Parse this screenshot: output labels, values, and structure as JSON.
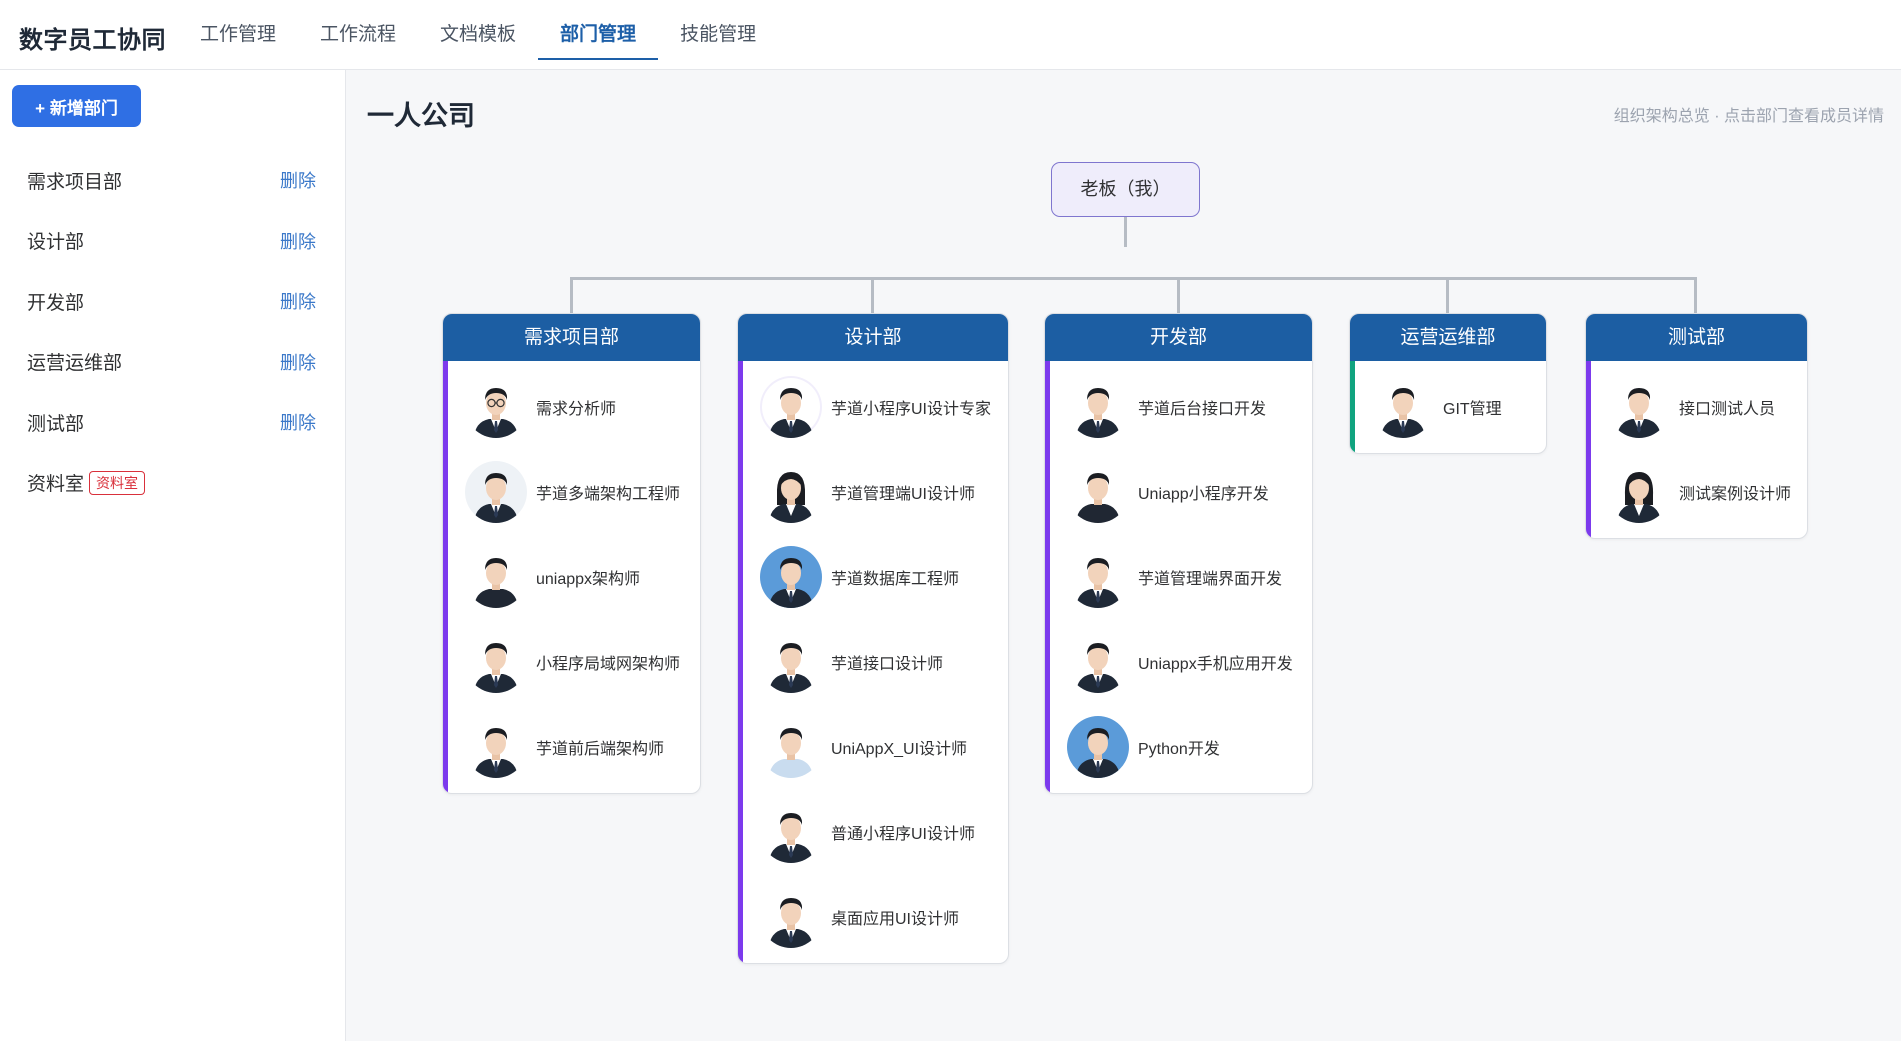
{
  "app": {
    "title": "数字员工协同"
  },
  "nav": {
    "items": [
      {
        "label": "工作管理",
        "active": false
      },
      {
        "label": "工作流程",
        "active": false
      },
      {
        "label": "文档模板",
        "active": false
      },
      {
        "label": "部门管理",
        "active": true
      },
      {
        "label": "技能管理",
        "active": false
      }
    ]
  },
  "sidebar": {
    "add_button": "+ 新增部门",
    "departments": [
      {
        "name": "需求项目部",
        "action": "删除"
      },
      {
        "name": "设计部",
        "action": "删除"
      },
      {
        "name": "开发部",
        "action": "删除"
      },
      {
        "name": "运营运维部",
        "action": "删除"
      },
      {
        "name": "测试部",
        "action": "删除"
      }
    ],
    "archive": {
      "name": "资料室",
      "tag": "资料室"
    }
  },
  "main": {
    "title": "一人公司",
    "hint": "组织架构总览 · 点击部门查看成员详情",
    "root": "老板（我）",
    "colors": {
      "header": "#1c5ea3",
      "accent_purple": "#7c3aed",
      "accent_green": "#10a37f",
      "primary": "#2f6fe4"
    },
    "departments": [
      {
        "name": "需求项目部",
        "members": [
          "需求分析师",
          "芋道多端架构工程师",
          "uniappx架构师",
          "小程序局域网架构师",
          "芋道前后端架构师"
        ]
      },
      {
        "name": "设计部",
        "members": [
          "芋道小程序UI设计专家",
          "芋道管理端UI设计师",
          "芋道数据库工程师",
          "芋道接口设计师",
          "UniAppX_UI设计师",
          "普通小程序UI设计师",
          "桌面应用UI设计师"
        ]
      },
      {
        "name": "开发部",
        "members": [
          "芋道后台接口开发",
          "Uniapp小程序开发",
          "芋道管理端界面开发",
          "Uniappx手机应用开发",
          "Python开发"
        ]
      },
      {
        "name": "运营运维部",
        "members": [
          "GIT管理"
        ]
      },
      {
        "name": "测试部",
        "members": [
          "接口测试人员",
          "测试案例设计师"
        ]
      }
    ]
  }
}
